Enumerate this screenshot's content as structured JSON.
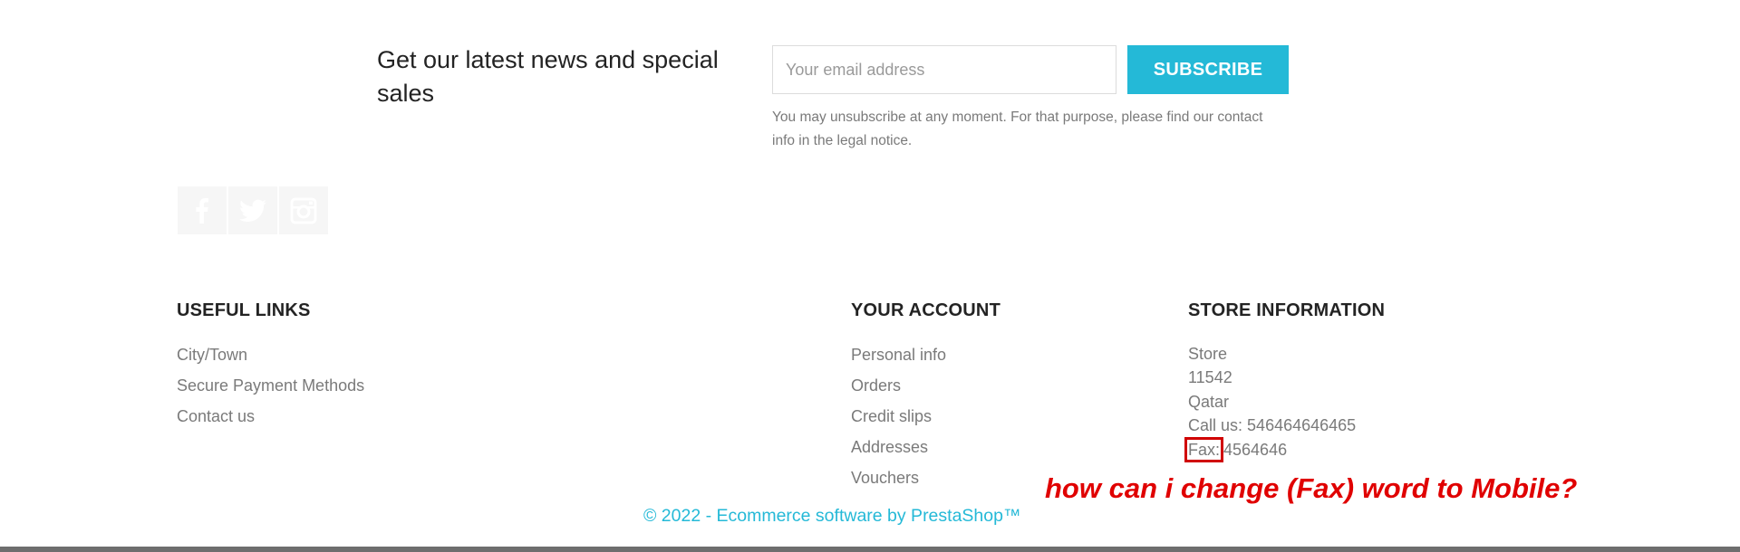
{
  "newsletter": {
    "title": "Get our latest news and special sales",
    "email_placeholder": "Your email address",
    "subscribe_label": "SUBSCRIBE",
    "legal_note": "You may unsubscribe at any moment. For that purpose, please find our contact info in the legal notice."
  },
  "social": {
    "items": [
      {
        "name": "facebook",
        "icon": "facebook-icon"
      },
      {
        "name": "twitter",
        "icon": "twitter-icon"
      },
      {
        "name": "instagram",
        "icon": "instagram-icon"
      }
    ]
  },
  "useful_links": {
    "title": "USEFUL LINKS",
    "items": [
      "City/Town",
      "Secure Payment Methods",
      "Contact us"
    ]
  },
  "your_account": {
    "title": "YOUR ACCOUNT",
    "items": [
      "Personal info",
      "Orders",
      "Credit slips",
      "Addresses",
      "Vouchers"
    ]
  },
  "store_information": {
    "title": "STORE INFORMATION",
    "name": "Store",
    "postcode": "11542",
    "country": "Qatar",
    "call_label": "Call us:",
    "call_value": "546464646465",
    "fax_label": "Fax:",
    "fax_value": "4564646"
  },
  "copyright": "© 2022 - Ecommerce software by PrestaShop™",
  "annotation": "how can i change (Fax) word to Mobile?",
  "colors": {
    "accent": "#24b9d7",
    "annotation": "#e00000",
    "text_dark": "#232323",
    "text_muted": "#7a7a7a"
  }
}
